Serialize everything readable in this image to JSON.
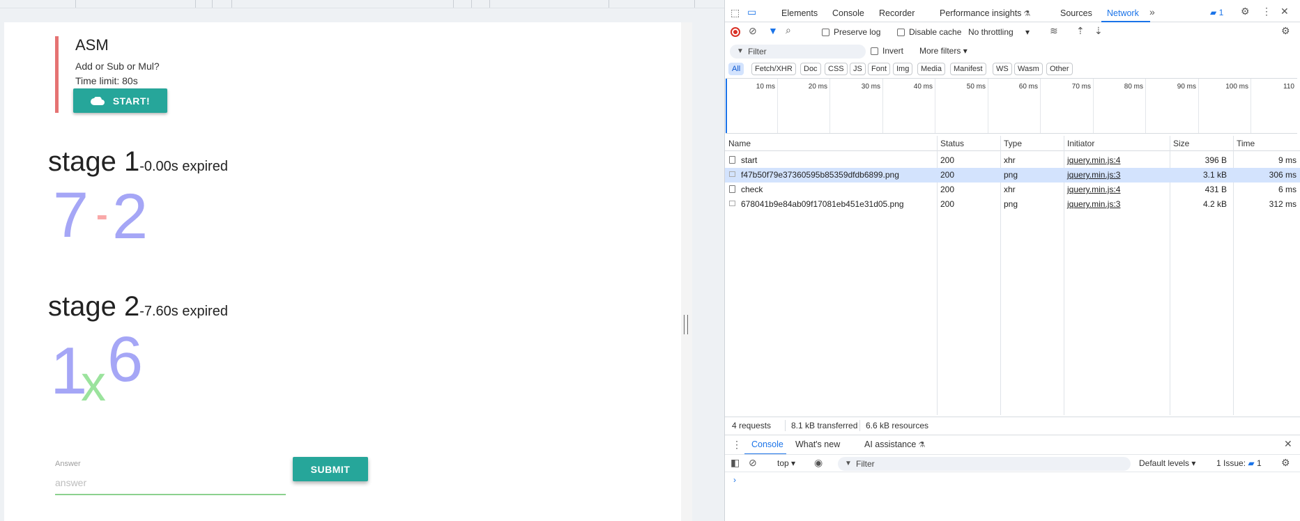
{
  "page": {
    "task": {
      "title": "ASM",
      "question": "Add or Sub or Mul?",
      "time_limit": "Time limit: 80s",
      "start_label": "START!"
    },
    "stages": [
      {
        "title": "stage 1",
        "expired": "-0.00s expired",
        "captcha": {
          "a": "7",
          "op": "-",
          "b": "2"
        }
      },
      {
        "title": "stage 2",
        "expired": "-7.60s expired",
        "captcha": {
          "a": "1",
          "op": "x",
          "b": "6"
        }
      }
    ],
    "answer": {
      "label": "Answer",
      "placeholder": "answer",
      "value": ""
    },
    "submit_label": "SUBMIT",
    "colors": {
      "accent": "#26a69a",
      "card_border": "#e57373",
      "digit": "#a5a6f6",
      "minus": "#f9a8a8",
      "times": "#9be39d",
      "input_line": "#8bd18e"
    }
  },
  "devtools": {
    "tabs": [
      "Elements",
      "Console",
      "Recorder",
      "Performance insights",
      "Sources",
      "Network"
    ],
    "active_tab": "Network",
    "issues_badge": "1",
    "toolbar": {
      "preserve_log": "Preserve log",
      "disable_cache": "Disable cache",
      "throttling": "No throttling"
    },
    "filter": {
      "placeholder": "Filter",
      "invert": "Invert",
      "more_filters": "More filters"
    },
    "type_filters": [
      "All",
      "Fetch/XHR",
      "Doc",
      "CSS",
      "JS",
      "Font",
      "Img",
      "Media",
      "Manifest",
      "WS",
      "Wasm",
      "Other"
    ],
    "timeline_ticks": [
      "10 ms",
      "20 ms",
      "30 ms",
      "40 ms",
      "50 ms",
      "60 ms",
      "70 ms",
      "80 ms",
      "90 ms",
      "100 ms",
      "110"
    ],
    "columns": [
      "Name",
      "Status",
      "Type",
      "Initiator",
      "Size",
      "Time"
    ],
    "requests": [
      {
        "name": "start",
        "status": "200",
        "type": "xhr",
        "initiator": "jquery.min.js:4",
        "size": "396 B",
        "time": "9 ms",
        "icon": "doc"
      },
      {
        "name": "f47b50f79e37360595b85359dfdb6899.png",
        "status": "200",
        "type": "png",
        "initiator": "jquery.min.js:3",
        "size": "3.1 kB",
        "time": "306 ms",
        "icon": "img",
        "selected": true
      },
      {
        "name": "check",
        "status": "200",
        "type": "xhr",
        "initiator": "jquery.min.js:4",
        "size": "431 B",
        "time": "6 ms",
        "icon": "doc"
      },
      {
        "name": "678041b9e84ab09f17081eb451e31d05.png",
        "status": "200",
        "type": "png",
        "initiator": "jquery.min.js:3",
        "size": "4.2 kB",
        "time": "312 ms",
        "icon": "img"
      }
    ],
    "summary": {
      "requests": "4 requests",
      "transferred": "8.1 kB transferred",
      "resources": "6.6 kB resources"
    },
    "drawer": {
      "tabs": [
        "Console",
        "What's new",
        "AI assistance"
      ],
      "context": "top",
      "filter_placeholder": "Filter",
      "levels": "Default levels",
      "issues": "1 Issue:",
      "issues_count": "1",
      "prompt": "›"
    }
  }
}
